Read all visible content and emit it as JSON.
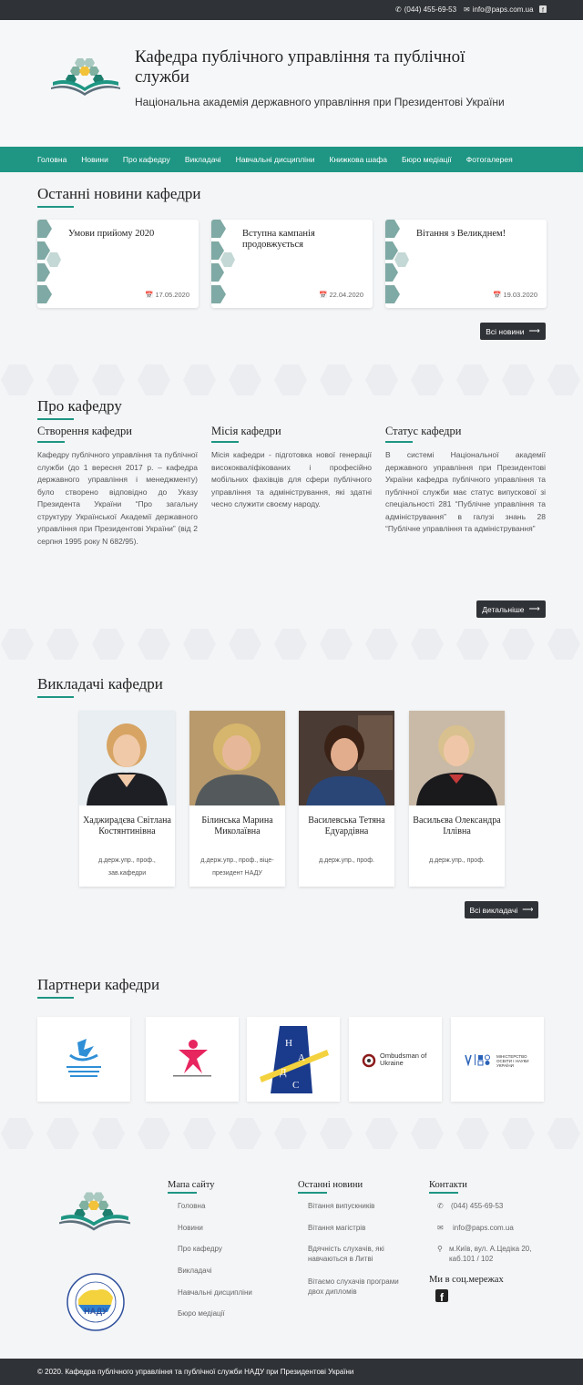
{
  "topbar": {
    "phone": "(044) 455-69-53",
    "email": "info@paps.com.ua"
  },
  "header": {
    "title": "Кафедра публічного управління та публічної служби",
    "subtitle": "Національна академія державного управління при Президентові України"
  },
  "nav": [
    "Головна",
    "Новини",
    "Про кафедру",
    "Викладачі",
    "Навчальні дисципліни",
    "Книжкова шафа",
    "Бюро медіації",
    "Фотогалерея"
  ],
  "news": {
    "title": "Останні новини кафедри",
    "items": [
      {
        "title": "Умови прийому 2020",
        "date": "17.05.2020"
      },
      {
        "title": "Вступна кампанія продовжується",
        "date": "22.04.2020"
      },
      {
        "title": "Вітання з Великднем!",
        "date": "19.03.2020"
      }
    ],
    "all": "Всі новини"
  },
  "about": {
    "title": "Про кафедру",
    "cols": [
      {
        "title": "Створення кафедри",
        "text": "Кафедру публічного управління та публічної служби (до 1 вересня 2017 р. – кафедра державного управління і менеджменту) було створено відповідно до Указу Президента України “Про загальну структуру Української Академії державного управління при Президентові України” (від 2 серпня 1995 року N 682/95)."
      },
      {
        "title": "Місія кафедри",
        "text": "Місія кафедри - підготовка нової генерації висококваліфікованих і професійно мобільних фахівців для сфери публічного управління та адміністрування, які здатні чесно служити своєму народу."
      },
      {
        "title": "Статус кафедри",
        "text": "В системі Національної академії державного управління при Президентові України кафедра публічного управління та публічної служби має статус випускової зі спеціальності 281 “Публічне управління та адміністрування” в галузі знань 28 “Публічне управління та адміністрування”"
      }
    ],
    "more": "Детальніше"
  },
  "teachers": {
    "title": "Викладачі кафедри",
    "items": [
      {
        "name": "Хаджирадєва Світлана Костянтинівна",
        "pos": "д.держ.упр., проф., зав.кафедри"
      },
      {
        "name": "Білинська Марина Миколаївна",
        "pos": "д.держ.упр., проф., віце-президент НАДУ"
      },
      {
        "name": "Василевська Тетяна Едуардівна",
        "pos": "д.держ.упр., проф."
      },
      {
        "name": "Васильєва Олександра Іллівна",
        "pos": "д.держ.упр., проф."
      }
    ],
    "all": "Всі викладачі"
  },
  "partners": {
    "title": "Партнери кафедри",
    "ombudsman": "Ombudsman of Ukraine",
    "ministry": "МІНІСТЕРСТВО ОСВІТИ І НАУКИ УКРАЇНИ"
  },
  "footer": {
    "map_title": "Мапа сайту",
    "map": [
      "Головна",
      "Новини",
      "Про кафедру",
      "Викладачі",
      "Навчальні дисципліни",
      "Бюро медіації"
    ],
    "news_title": "Останні новини",
    "news": [
      "Вітання випускників",
      "Вітання магістрів",
      "Вдячність слухачів, які навчаються в Литві",
      "Вітаємо слухачів програми двох дипломів"
    ],
    "contacts_title": "Контакти",
    "phone": "(044) 455-69-53",
    "email": "info@paps.com.ua",
    "address": "м.Київ, вул. А.Цедіка 20, каб.101 / 102",
    "social_title": "Ми в соц.мережах",
    "nadu": "НАДУ"
  },
  "copyright": "© 2020. Кафедра публічного управління та публічної служби НАДУ при Президентові України",
  "colors": {
    "accent": "#1e9683",
    "dark": "#2f3236"
  }
}
